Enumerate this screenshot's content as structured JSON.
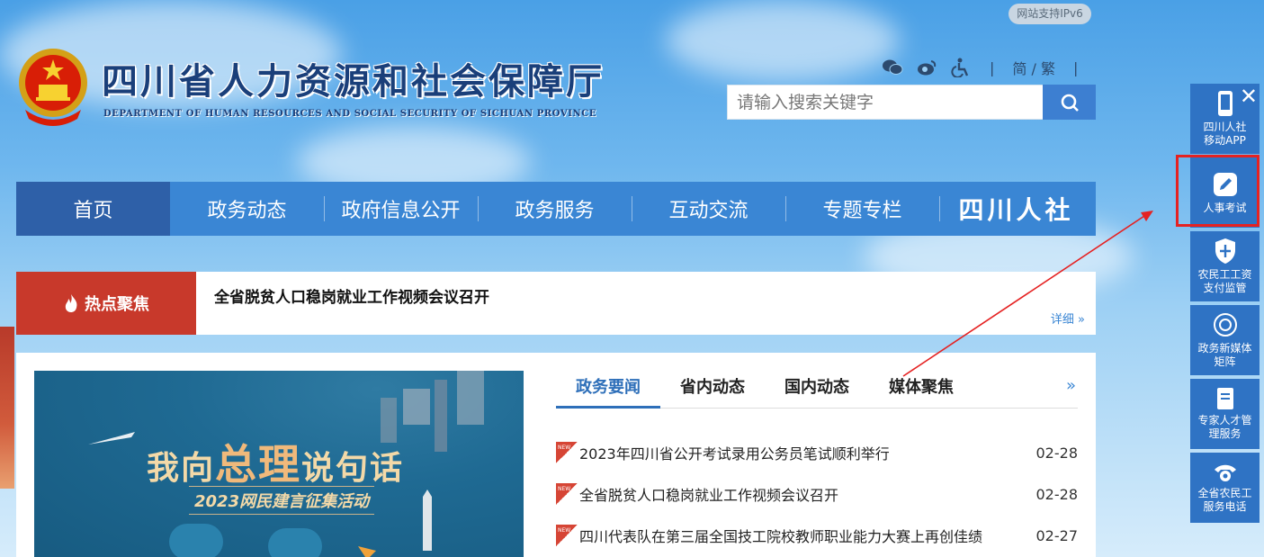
{
  "ipv6_badge": "网站支持IPv6",
  "site": {
    "title": "四川省人力资源和社会保障厅",
    "subtitle": "DEPARTMENT OF HUMAN RESOURCES AND SOCIAL SECURITY OF SICHUAN PROVINCE"
  },
  "toplinks": {
    "icons": [
      "wechat-icon",
      "weibo-icon",
      "accessibility-icon"
    ],
    "lang": "简 / 繁",
    "sep": "|"
  },
  "search": {
    "placeholder": "请输入搜索关键字"
  },
  "nav": {
    "items": [
      {
        "label": "首页",
        "active": true
      },
      {
        "label": "政务动态"
      },
      {
        "label": "政府信息公开"
      },
      {
        "label": "政务服务"
      },
      {
        "label": "互动交流"
      },
      {
        "label": "专题专栏"
      }
    ],
    "brand": "四川人社"
  },
  "hot": {
    "label": "热点聚焦",
    "title": "全省脱贫人口稳岗就业工作视频会议召开",
    "more": "详细 »"
  },
  "banner": {
    "title_a": "我向",
    "title_big": "总理",
    "title_b": "说句话",
    "subtitle": "2023网民建言征集活动"
  },
  "tabs": [
    {
      "label": "政务要闻",
      "active": true
    },
    {
      "label": "省内动态"
    },
    {
      "label": "国内动态"
    },
    {
      "label": "媒体聚焦"
    }
  ],
  "tabs_more": "»",
  "news": [
    {
      "title": "2023年四川省公开考试录用公务员笔试顺利举行",
      "date": "02-28",
      "badge": "NEW"
    },
    {
      "title": "全省脱贫人口稳岗就业工作视频会议召开",
      "date": "02-28",
      "badge": "NEW"
    },
    {
      "title": "四川代表队在第三届全国技工院校教师职业能力大赛上再创佳绩",
      "date": "02-27",
      "badge": "NEW"
    }
  ],
  "side": {
    "close": "✕",
    "items": [
      {
        "label": "四川人社\n移动APP",
        "icon": "mobile-icon"
      },
      {
        "label": "人事考试",
        "icon": "pencil-icon"
      },
      {
        "label": "农民工工资\n支付监管",
        "icon": "shield-icon"
      },
      {
        "label": "政务新媒体\n矩阵",
        "icon": "media-icon"
      },
      {
        "label": "专家人才管\n理服务",
        "icon": "book-icon"
      },
      {
        "label": "全省农民工\n服务电话",
        "icon": "phone-icon"
      }
    ]
  },
  "colors": {
    "nav": "#3a86d4",
    "nav_active": "#2e60a8",
    "hot": "#c8392b",
    "side": "#2f73c4",
    "highlight": "#e52222"
  }
}
